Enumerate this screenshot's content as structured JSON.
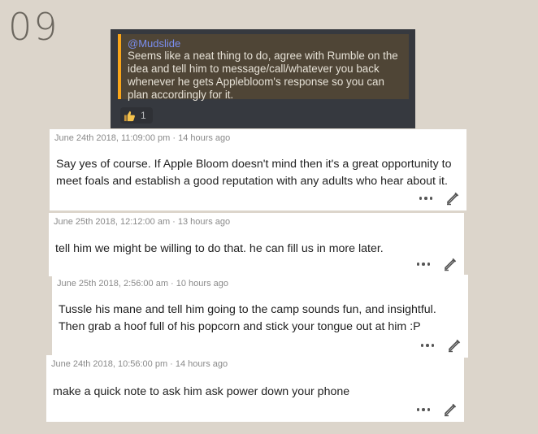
{
  "page_number": "09",
  "discord_message": {
    "author": "@Mudslide",
    "text": "Seems like a neat thing to do, agree with Rumble on the idea and tell him to message/call/whatever you back whenever he gets Applebloom's response so you can plan accordingly for it.",
    "reaction": {
      "icon": "thumbs-up-icon",
      "count": "1"
    }
  },
  "comments": [
    {
      "meta": "June 24th 2018, 11:09:00 pm · 14 hours ago",
      "text": "Say yes of course. If Apple Bloom doesn't mind then it's a great opportunity to meet foals and establish a good reputation with any adults who hear about it."
    },
    {
      "meta": "June 25th 2018, 12:12:00 am · 13 hours ago",
      "text": "tell him we might be willing to do that. he can fill us in more later."
    },
    {
      "meta": "June 25th 2018, 2:56:00 am · 10 hours ago",
      "text": "Tussle his mane and tell him going to the camp sounds fun, and insightful. Then grab a hoof full of his popcorn and stick your tongue out at him :P"
    },
    {
      "meta": "June 24th 2018, 10:56:00 pm · 14 hours ago",
      "text": "make a quick note to ask him ask power down your phone"
    }
  ],
  "icons": {
    "more": "more-dots-icon",
    "edit": "pencil-icon"
  }
}
